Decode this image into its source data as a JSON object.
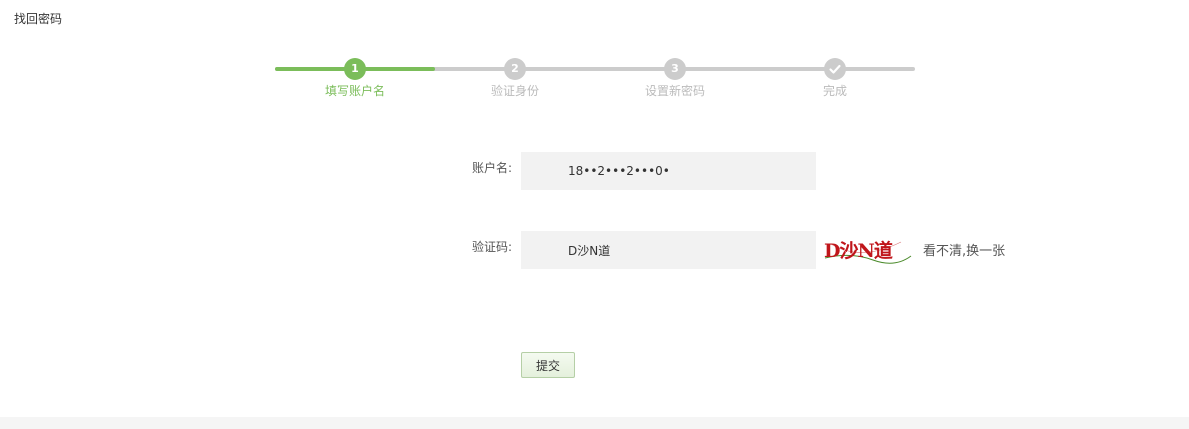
{
  "page": {
    "title": "找回密码"
  },
  "stepper": {
    "progress": 0.25,
    "steps": [
      {
        "number": "1",
        "label": "填写账户名",
        "status": "active"
      },
      {
        "number": "2",
        "label": "验证身份",
        "status": "pending"
      },
      {
        "number": "3",
        "label": "设置新密码",
        "status": "pending"
      },
      {
        "number": "",
        "label": "完成",
        "status": "pending",
        "icon": "check-icon"
      }
    ]
  },
  "form": {
    "account_label": "账户名:",
    "account_value": "18••2•••2•••0•",
    "captcha_label": "验证码:",
    "captcha_value": "D沙N道",
    "captcha_image_text": "D沙N道",
    "refresh_link": "看不清,换一张",
    "submit_label": "提交"
  },
  "colors": {
    "accent": "#7bbd5a",
    "inactive": "#cccccc",
    "input_bg": "#f2f2f2",
    "captcha_text": "#c0161b"
  }
}
